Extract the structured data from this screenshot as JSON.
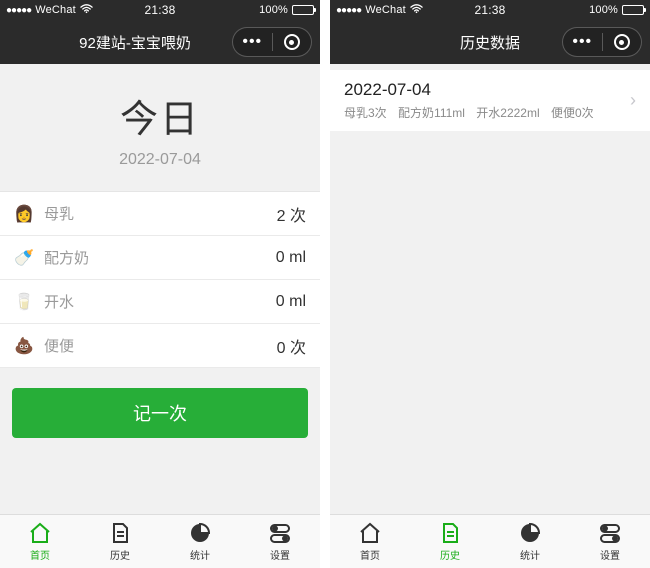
{
  "status": {
    "carrier": "WeChat",
    "time": "21:38",
    "battery_pct": "100%"
  },
  "screens": {
    "home": {
      "title": "92建站-宝宝喂奶",
      "hero_title": "今日",
      "hero_date": "2022-07-04",
      "rows": {
        "breast": {
          "label": "母乳",
          "value": "2 次"
        },
        "formula": {
          "label": "配方奶",
          "value": "0 ml"
        },
        "water": {
          "label": "开水",
          "value": "0 ml"
        },
        "poop": {
          "label": "便便",
          "value": "0 次"
        }
      },
      "record_btn": "记一次"
    },
    "history": {
      "title": "历史数据",
      "items": [
        {
          "date": "2022-07-04",
          "breast": "母乳3次",
          "formula": "配方奶111ml",
          "water": "开水2222ml",
          "poop": "便便0次"
        }
      ]
    }
  },
  "tabs": {
    "home": "首页",
    "history": "历史",
    "stats": "统计",
    "settings": "设置"
  }
}
